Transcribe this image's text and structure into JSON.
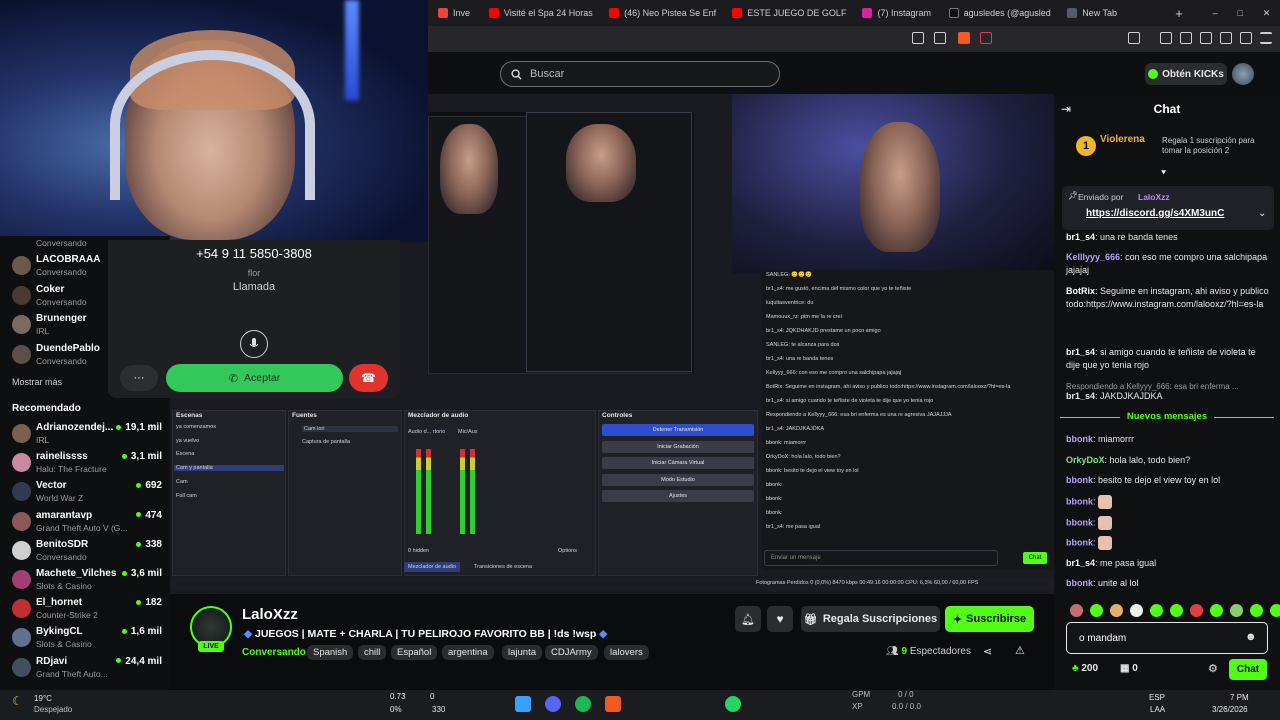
{
  "browser": {
    "tabs": [
      {
        "label": "Inve",
        "color": "#e8463b"
      },
      {
        "label": "Visité el Spa 24 Horas",
        "color": "#ff0000"
      },
      {
        "label": "(46) Neo Pistea Se Enf",
        "color": "#ff0000"
      },
      {
        "label": "ESTE JUEGO DE GOLF",
        "color": "#ff0000"
      },
      {
        "label": "(7) Instagram",
        "color": "#d6249f"
      },
      {
        "label": "agusledes (@agusled",
        "color": "#111111"
      },
      {
        "label": "New Tab",
        "color": "#555a66"
      }
    ],
    "new_tab_glyph": "+",
    "window_controls": [
      "–",
      "□",
      "✕"
    ]
  },
  "kick": {
    "search_placeholder": "Buscar",
    "get_kicks": "Obtén KICKs"
  },
  "sidebar": {
    "partial_top": "Conversando",
    "followed": [
      {
        "name": "LACOBRAAA",
        "sub": "Conversando",
        "color": "#6b5a4a"
      },
      {
        "name": "Coker",
        "sub": "Conversando",
        "color": "#4a3a32"
      },
      {
        "name": "Brunenger",
        "sub": "IRL",
        "color": "#7a6a60"
      },
      {
        "name": "DuendePablo",
        "sub": "Conversando",
        "color": "#5a5048"
      }
    ],
    "show_more": "Mostrar más",
    "recommended_heading": "Recomendado",
    "recommended": [
      {
        "name": "Adrianozendej...",
        "sub": "IRL",
        "count": "19,1 mil",
        "color": "#7a6050"
      },
      {
        "name": "rainelissss",
        "sub": "Halu: The Fracture",
        "count": "3,1 mil",
        "color": "#c98aa0"
      },
      {
        "name": "Vector",
        "sub": "World War Z",
        "count": "692",
        "color": "#303a50"
      },
      {
        "name": "amarantavp",
        "sub": "Grand Theft Auto V (G...",
        "count": "474",
        "color": "#8a5a5a"
      },
      {
        "name": "BenitoSDR",
        "sub": "Conversando",
        "count": "338",
        "color": "#d0d0d0"
      },
      {
        "name": "Machete_Vilches",
        "sub": "Slots & Casino",
        "count": "3,6 mil",
        "color": "#a04070"
      },
      {
        "name": "El_hornet",
        "sub": "Counter-Strike 2",
        "count": "182",
        "color": "#c03030"
      },
      {
        "name": "BykingCL",
        "sub": "Slots & Casino",
        "count": "1,6 mil",
        "color": "#607090"
      },
      {
        "name": "RDjavi",
        "sub": "Grand Theft Auto...",
        "count": "24,4 mil",
        "color": "#405060"
      }
    ]
  },
  "call": {
    "number": "+54 9 11 5850-3808",
    "name": "flor",
    "status": "Llamada",
    "more": "···",
    "accept": "Aceptar"
  },
  "obs": {
    "panels": {
      "scenes": "Escenas",
      "sources": "Fuentes",
      "mixer": "Mezclador de audio",
      "controls": "Controles"
    },
    "scenes": [
      "ya comenzamos",
      "ya vuelvo",
      "Escena",
      "Cam y pantalla",
      "Cam",
      "Full cam"
    ],
    "sources": [
      "Cam lori",
      "Captura de pantalla"
    ],
    "mixer_tracks": [
      "Audio d... rtorio",
      "Mic/Aux"
    ],
    "mixer_tabs": [
      "Mezclador de audio",
      "Transiciones de escena"
    ],
    "hidden": "0 hidden",
    "options": "Options",
    "controls": [
      "Detener Transmisión",
      "Iniciar Grabación",
      "Iniciar Cámara Virtual",
      "Modo Estudio",
      "Ajustes"
    ],
    "status": "Fotogramas Perdidos 0 (0,0%)   8470 kbps   00:49:16   00:00:00   CPU: 6,3%   60,00 / 60,00 FPS",
    "mini_chat_placeholder": "Enviar un mensaje",
    "mini_chat_send": "Chat",
    "mini_chat": [
      "SANLEG: 🙂🙂🙂",
      "br1_s4: me gustó, encima del mismo color que yo te teñiste",
      "luquitasventrice: du",
      "Mamouux_rz: ptm me la re creí",
      "br1_s4: JQKDHAKJD prestame un poco amigo",
      "SANLEG: te alcanza para dos",
      "br1_s4: una re banda tenes",
      "Kellyyy_666: con eso me compro una salchipapa jajajaj",
      "BotRix: Seguime en instagram, ahi aviso y publico todo:https://www.instagram.com/lalooxz/?hl=es-la",
      "br1_s4: si amigo cuando te teñiste de violeta te dije que yo tenia rojo",
      "Respondiendo a Kellyyy_666: esa bri enferma es una re agresiva JAJAJJJA",
      "br1_s4: JAKDJKAJDKA",
      "bbonk: miamorrr",
      "OrkyDoX: hola lalo, todo bien?",
      "bbonk: besito te dejo el view toy en lol",
      "bbonk:",
      "bbonk:",
      "bbonk:",
      "br1_s4: me pasa igual"
    ]
  },
  "channel": {
    "name": "LaloXzz",
    "live": "LIVE",
    "title": "JUEGOS | MATE + CHARLA | TU PELIROJO FAVORITO BB | !ds !wsp",
    "category": "Conversando",
    "tags": [
      "Spanish",
      "chill",
      "Español",
      "argentina",
      "lajunta",
      "CDJArmy",
      "lalovers"
    ],
    "gift": "Regala Suscripciones",
    "subscribe": "Suscribirse",
    "viewers_count": "9",
    "viewers_label": "Espectadores"
  },
  "chat": {
    "title": "Chat",
    "leader_rank": "1",
    "leader_name": "Violerena",
    "leader_prompt": "Regala 1 suscripción para tomar la posición 2",
    "pinned_by_label": "Enviado por",
    "pinned_by": "LaloXzz",
    "pinned_link": "https://discord.gg/s4XM3unC",
    "messages_before": [
      {
        "user": "br1_s4",
        "color": "#ffffff",
        "text": "una re banda tenes"
      },
      {
        "user": "Kelllyyy_666",
        "color": "#b6a1ff",
        "text": "con eso me compro una salchipapa jajajaj"
      },
      {
        "user": "BotRix",
        "color": "#ffffff",
        "text": "Seguime en instagram, ahi aviso y publico todo:https://www.instagram.com/lalooxz/?hl=es-la"
      },
      {
        "user": "br1_s4",
        "color": "#ffffff",
        "text": "si amigo cuando te teñiste de violeta te dije que yo tenia rojo"
      }
    ],
    "reply_hint": "Respondiendo a Kellyyy_666: esa bri enferma ...",
    "reply_msg": {
      "user": "br1_s4",
      "text": "JAKDJKAJDKA"
    },
    "new_messages": "Nuevos mensajes",
    "messages_after": [
      {
        "user": "bbonk",
        "color": "#b6a1ff",
        "text": "miamorrr"
      },
      {
        "user": "OrkyDoX",
        "color": "#7ee08a",
        "text": "hola lalo, todo bien?"
      },
      {
        "user": "bbonk",
        "color": "#b6a1ff",
        "text": "besito te dejo el view toy en lol"
      },
      {
        "user": "bbonk",
        "color": "#b6a1ff",
        "text": ""
      },
      {
        "user": "bbonk",
        "color": "#b6a1ff",
        "text": ""
      },
      {
        "user": "bbonk",
        "color": "#b6a1ff",
        "text": ""
      },
      {
        "user": "br1_s4",
        "color": "#ffffff",
        "text": "me pasa igual"
      },
      {
        "user": "bbonk",
        "color": "#b6a1ff",
        "text": "unite al lol"
      }
    ],
    "input_value": "o mandam",
    "kicks": "200",
    "store_count": "0",
    "send": "Chat"
  },
  "taskbar": {
    "weather_temp": "19°C",
    "weather_desc": "Despejado",
    "stat_1": "0.73",
    "stat_2": "0%",
    "stat_3": "0",
    "stat_4": "330",
    "gpm_label": "GPM",
    "gpm_value": "0 / 0",
    "xp_label": "XP",
    "xp_value": "0.0 / 0.0",
    "lang_1": "ESP",
    "lang_2": "LAA",
    "time": "7 PM",
    "date": "3/26/2026"
  },
  "accent": "#53fc18"
}
